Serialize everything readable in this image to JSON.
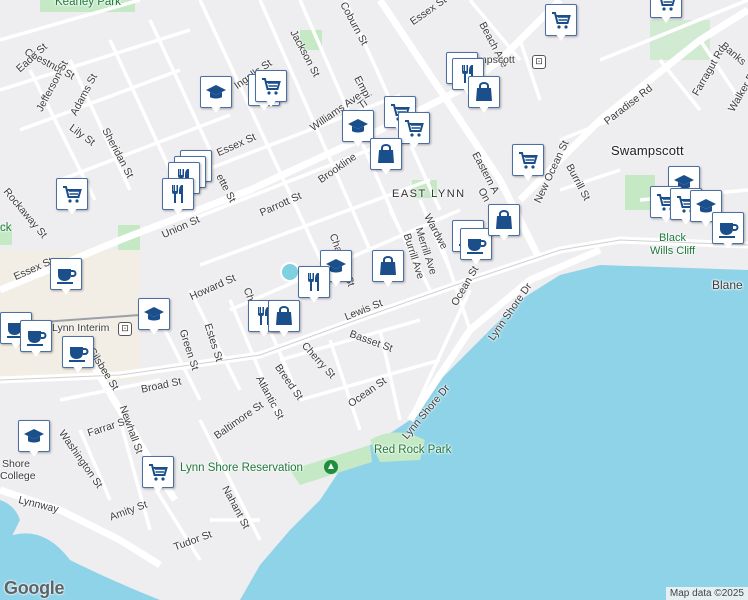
{
  "map": {
    "attribution": "Map data ©2025",
    "logo": "Google",
    "colors": {
      "water": "#8fd3e8",
      "land": "#eeedf0",
      "park": "#c5e8c5",
      "major_road": "#ffffff",
      "pin_blue": "#1a4f8b"
    }
  },
  "labels": {
    "keaney_park": "Keaney Park",
    "chestnut_st": "Chestnut St",
    "eade_st": "Eade St",
    "jefferson_st": "Jefferson St",
    "adams_st": "Adams St",
    "lily_st": "Lily St",
    "sheridan_st": "Sheridan St",
    "rockaway_st": "Rockaway St",
    "union_st": "Union St",
    "essex_st_w": "Essex St",
    "essex_st_mid": "Essex St",
    "essex_st_ne": "Essex St",
    "ingalls_st": "Ingalls St",
    "jackson_st": "Jackson St",
    "coburn_st": "Coburn St",
    "williams_ave": "Williams Ave",
    "empire_st": "Empi",
    "tirrell_st": "Ti",
    "brookline_st": "Brookline",
    "parrott_st": "Parrott St",
    "lafayette_st": "ette St",
    "beach_ave": "Beach Ave",
    "swampscott_station": "mpscott",
    "paradise_rd": "Paradise Rd",
    "farragut_rd": "Farragut Rd",
    "walker_rd": "Walker R",
    "banks": "Banks",
    "swampscott": "Swampscott",
    "east_lynn": "EAST LYNN",
    "eastern_ave": "Eastern A",
    "new_ocean_st": "New Ocean St",
    "burrill_st": "Burrill St",
    "ocean_st_n": "On",
    "wardwell": "Wardwe",
    "merrill_ave": "Merrill Ave",
    "burrill_ave": "Burrill Ave",
    "chatham_st": "Chatham St",
    "howard_st": "Howard St",
    "chestnut_st_s": "Ch",
    "estes_st": "Estes St",
    "green_st": "Green St",
    "lewis_st": "Lewis St",
    "basset_st": "Basset St",
    "cherry_st": "Cherry St",
    "ocean_st_mid": "Ocean St",
    "ocean_st_s": "Ocean St",
    "lynn_shore_dr_n": "Lynn Shore Dr",
    "lynn_shore_dr_s": "Lynn Shore Dr",
    "lynn_interim": "Lynn Interim",
    "silsbee_st": "Silsbee St",
    "broad_st": "Broad St",
    "breed_st": "Breed St",
    "atlantic_st": "Atlantic St",
    "baltimore_st": "Baltimore St",
    "farrar_st": "Farrar St",
    "newhall_st": "Newhall St",
    "washington_st": "Washington St",
    "amity_st": "Amity St",
    "nahant_st": "Nahant St",
    "tudor_st": "Tudor St",
    "lynnway": "Lynnway",
    "north_shore_college_1": "Shore",
    "north_shore_college_2": "College",
    "red_rock_park": "Red Rock Park",
    "lynn_shore_reservation": "Lynn Shore Reservation",
    "black_wills_cliff_1": "Black",
    "black_wills_cliff_2": "Wills Cliff",
    "blaney": "Blane",
    "ck": "ck"
  },
  "pins": [
    {
      "type": "grocery",
      "name": "grocery-pin"
    },
    {
      "type": "education",
      "name": "school-pin"
    },
    {
      "type": "grocery",
      "name": "grocery-pin"
    },
    {
      "type": "restaurant",
      "name": "restaurant-pin"
    },
    {
      "type": "shopping",
      "name": "shopping-pin"
    }
  ]
}
